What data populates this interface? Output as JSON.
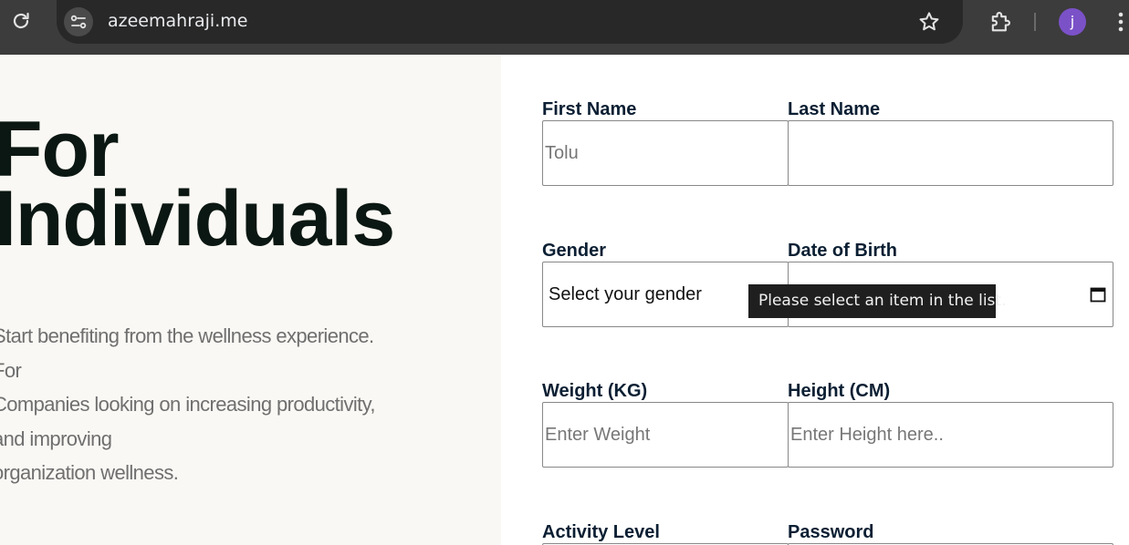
{
  "browser": {
    "url": "azeemahraji.me",
    "avatar_initial": "j",
    "icons": [
      "reload-icon",
      "site-info-icon",
      "bookmark-star-icon",
      "extensions-icon",
      "menu-kebab-icon"
    ]
  },
  "hero": {
    "title_line1": "For",
    "title_line2": "Individuals",
    "text_lines": [
      "Start benefiting from the wellness experience.",
      "For",
      "Companies looking on increasing productivity,",
      "and improving",
      "organization wellness."
    ]
  },
  "form": {
    "first_name": {
      "label": "First Name",
      "placeholder": "Tolu"
    },
    "last_name": {
      "label": "Last Name",
      "placeholder": ""
    },
    "gender": {
      "label": "Gender",
      "selected": "Select your gender"
    },
    "dob": {
      "label": "Date of Birth"
    },
    "weight": {
      "label": "Weight (KG)",
      "placeholder": "Enter Weight"
    },
    "height": {
      "label": "Height (CM)",
      "placeholder": "Enter Height here.."
    },
    "activity_level": {
      "label": "Activity Level"
    },
    "password": {
      "label": "Password"
    }
  },
  "tooltip": {
    "text": "Please select an item in the list."
  },
  "colors": {
    "chrome_bg": "#3c3c3c",
    "omnibox_bg": "#282828",
    "avatar": "#7b51c8",
    "left_panel_bg": "#faf8f4",
    "heading": "#0b1712",
    "label": "#0b1f33"
  }
}
